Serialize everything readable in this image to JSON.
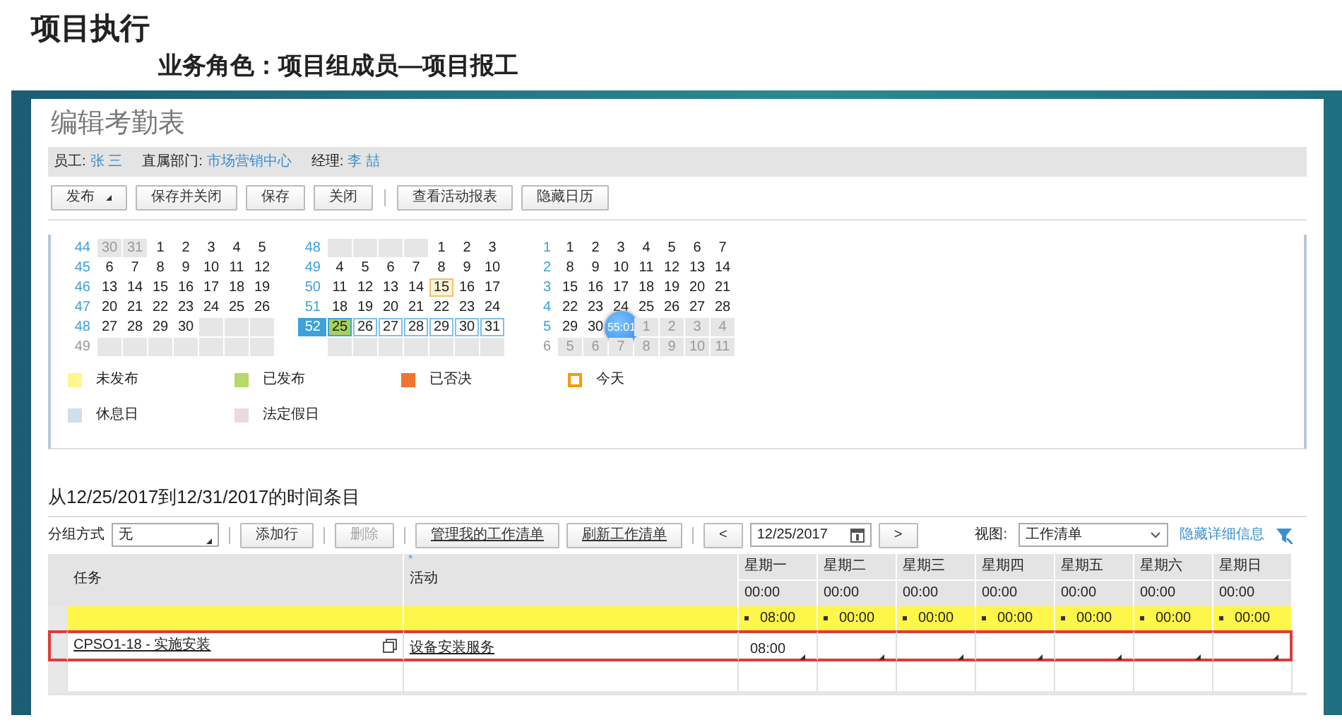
{
  "slide": {
    "title": "项目执行",
    "subtitle": "业务角色：项目组成员—项目报工"
  },
  "window": {
    "title": "编辑考勤表"
  },
  "info_bar": [
    {
      "label": "员工:",
      "value": "张 三"
    },
    {
      "label": "直属部门:",
      "value": "市场营销中心"
    },
    {
      "label": "经理:",
      "value": "李 喆"
    }
  ],
  "toolbar": [
    {
      "kind": "menu",
      "label": "发布"
    },
    {
      "kind": "button",
      "label": "保存并关闭"
    },
    {
      "kind": "button",
      "label": "保存"
    },
    {
      "kind": "button",
      "label": "关闭"
    },
    {
      "kind": "separator"
    },
    {
      "kind": "button",
      "label": "查看活动报表"
    },
    {
      "kind": "button",
      "label": "隐藏日历"
    }
  ],
  "calendar": {
    "months": [
      {
        "weeks": [
          {
            "week": "44",
            "dim": false,
            "selected": false,
            "days": [
              {
                "day": "30",
                "kind": "other"
              },
              {
                "day": "31",
                "kind": "other"
              },
              {
                "day": "1",
                "kind": "day"
              },
              {
                "day": "2",
                "kind": "day"
              },
              {
                "day": "3",
                "kind": "day"
              },
              {
                "day": "4",
                "kind": "day"
              },
              {
                "day": "5",
                "kind": "day"
              }
            ]
          },
          {
            "week": "45",
            "dim": false,
            "selected": false,
            "days": [
              {
                "day": "6",
                "kind": "day"
              },
              {
                "day": "7",
                "kind": "day"
              },
              {
                "day": "8",
                "kind": "day"
              },
              {
                "day": "9",
                "kind": "day"
              },
              {
                "day": "10",
                "kind": "day"
              },
              {
                "day": "11",
                "kind": "day"
              },
              {
                "day": "12",
                "kind": "day"
              }
            ]
          },
          {
            "week": "46",
            "dim": false,
            "selected": false,
            "days": [
              {
                "day": "13",
                "kind": "day"
              },
              {
                "day": "14",
                "kind": "day"
              },
              {
                "day": "15",
                "kind": "day"
              },
              {
                "day": "16",
                "kind": "day"
              },
              {
                "day": "17",
                "kind": "day"
              },
              {
                "day": "18",
                "kind": "day"
              },
              {
                "day": "19",
                "kind": "day"
              }
            ]
          },
          {
            "week": "47",
            "dim": false,
            "selected": false,
            "days": [
              {
                "day": "20",
                "kind": "day"
              },
              {
                "day": "21",
                "kind": "day"
              },
              {
                "day": "22",
                "kind": "day"
              },
              {
                "day": "23",
                "kind": "day"
              },
              {
                "day": "24",
                "kind": "day"
              },
              {
                "day": "25",
                "kind": "day"
              },
              {
                "day": "26",
                "kind": "day"
              }
            ]
          },
          {
            "week": "48",
            "dim": false,
            "selected": false,
            "days": [
              {
                "day": "27",
                "kind": "day"
              },
              {
                "day": "28",
                "kind": "day"
              },
              {
                "day": "29",
                "kind": "day"
              },
              {
                "day": "30",
                "kind": "day"
              },
              {
                "kind": "blank"
              },
              {
                "kind": "blank"
              },
              {
                "kind": "blank"
              }
            ]
          },
          {
            "week": "49",
            "dim": true,
            "selected": false,
            "days": [
              {
                "kind": "blank"
              },
              {
                "kind": "blank"
              },
              {
                "kind": "blank"
              },
              {
                "kind": "blank"
              },
              {
                "kind": "blank"
              },
              {
                "kind": "blank"
              },
              {
                "kind": "blank"
              }
            ]
          }
        ]
      },
      {
        "weeks": [
          {
            "week": "48",
            "dim": false,
            "selected": false,
            "days": [
              {
                "kind": "blank"
              },
              {
                "kind": "blank"
              },
              {
                "kind": "blank"
              },
              {
                "kind": "blank"
              },
              {
                "day": "1",
                "kind": "day"
              },
              {
                "day": "2",
                "kind": "day"
              },
              {
                "day": "3",
                "kind": "day"
              }
            ]
          },
          {
            "week": "49",
            "dim": false,
            "selected": false,
            "days": [
              {
                "day": "4",
                "kind": "day"
              },
              {
                "day": "5",
                "kind": "day"
              },
              {
                "day": "6",
                "kind": "day"
              },
              {
                "day": "7",
                "kind": "day"
              },
              {
                "day": "8",
                "kind": "day"
              },
              {
                "day": "9",
                "kind": "day"
              },
              {
                "day": "10",
                "kind": "day"
              }
            ]
          },
          {
            "week": "50",
            "dim": false,
            "selected": false,
            "days": [
              {
                "day": "11",
                "kind": "day"
              },
              {
                "day": "12",
                "kind": "day"
              },
              {
                "day": "13",
                "kind": "day"
              },
              {
                "day": "14",
                "kind": "day"
              },
              {
                "day": "15",
                "kind": "today"
              },
              {
                "day": "16",
                "kind": "day"
              },
              {
                "day": "17",
                "kind": "day"
              }
            ]
          },
          {
            "week": "51",
            "dim": false,
            "selected": false,
            "days": [
              {
                "day": "18",
                "kind": "day"
              },
              {
                "day": "19",
                "kind": "day"
              },
              {
                "day": "20",
                "kind": "day"
              },
              {
                "day": "21",
                "kind": "day"
              },
              {
                "day": "22",
                "kind": "day"
              },
              {
                "day": "23",
                "kind": "day"
              },
              {
                "day": "24",
                "kind": "day"
              }
            ]
          },
          {
            "week": "52",
            "dim": false,
            "selected": true,
            "days": [
              {
                "day": "25",
                "kind": "published"
              },
              {
                "day": "26",
                "kind": "inweek"
              },
              {
                "day": "27",
                "kind": "inweek"
              },
              {
                "day": "28",
                "kind": "inweek"
              },
              {
                "day": "29",
                "kind": "inweek"
              },
              {
                "day": "30",
                "kind": "inweek"
              },
              {
                "day": "31",
                "kind": "inweek"
              }
            ]
          },
          {
            "days": [
              {
                "kind": "blank"
              },
              {
                "kind": "blank"
              },
              {
                "kind": "blank"
              },
              {
                "kind": "blank"
              },
              {
                "kind": "blank"
              },
              {
                "kind": "blank"
              },
              {
                "kind": "blank"
              }
            ]
          }
        ]
      },
      {
        "weeks": [
          {
            "week": "1",
            "dim": false,
            "selected": false,
            "days": [
              {
                "day": "1",
                "kind": "day"
              },
              {
                "day": "2",
                "kind": "day"
              },
              {
                "day": "3",
                "kind": "day"
              },
              {
                "day": "4",
                "kind": "day"
              },
              {
                "day": "5",
                "kind": "day"
              },
              {
                "day": "6",
                "kind": "day"
              },
              {
                "day": "7",
                "kind": "day"
              }
            ]
          },
          {
            "week": "2",
            "dim": false,
            "selected": false,
            "days": [
              {
                "day": "8",
                "kind": "day"
              },
              {
                "day": "9",
                "kind": "day"
              },
              {
                "day": "10",
                "kind": "day"
              },
              {
                "day": "11",
                "kind": "day"
              },
              {
                "day": "12",
                "kind": "day"
              },
              {
                "day": "13",
                "kind": "day"
              },
              {
                "day": "14",
                "kind": "day"
              }
            ]
          },
          {
            "week": "3",
            "dim": false,
            "selected": false,
            "days": [
              {
                "day": "15",
                "kind": "day"
              },
              {
                "day": "16",
                "kind": "day"
              },
              {
                "day": "17",
                "kind": "day"
              },
              {
                "day": "18",
                "kind": "day"
              },
              {
                "day": "19",
                "kind": "day"
              },
              {
                "day": "20",
                "kind": "day"
              },
              {
                "day": "21",
                "kind": "day"
              }
            ]
          },
          {
            "week": "4",
            "dim": false,
            "selected": false,
            "days": [
              {
                "day": "22",
                "kind": "day"
              },
              {
                "day": "23",
                "kind": "day"
              },
              {
                "day": "24",
                "kind": "day"
              },
              {
                "day": "25",
                "kind": "day"
              },
              {
                "day": "26",
                "kind": "day"
              },
              {
                "day": "27",
                "kind": "day"
              },
              {
                "day": "28",
                "kind": "day"
              }
            ]
          },
          {
            "week": "5",
            "dim": false,
            "selected": false,
            "days": [
              {
                "day": "29",
                "kind": "day"
              },
              {
                "day": "30",
                "kind": "day"
              },
              {
                "day": "55:01",
                "kind": "timer"
              },
              {
                "day": "1",
                "kind": "other"
              },
              {
                "day": "2",
                "kind": "other"
              },
              {
                "day": "3",
                "kind": "other"
              },
              {
                "day": "4",
                "kind": "other"
              }
            ]
          },
          {
            "week": "6",
            "dim": true,
            "selected": false,
            "days": [
              {
                "day": "5",
                "kind": "other"
              },
              {
                "day": "6",
                "kind": "other"
              },
              {
                "day": "7",
                "kind": "other"
              },
              {
                "day": "8",
                "kind": "other"
              },
              {
                "day": "9",
                "kind": "other"
              },
              {
                "day": "10",
                "kind": "other"
              },
              {
                "day": "11",
                "kind": "other"
              }
            ]
          }
        ]
      }
    ],
    "legend": [
      {
        "label": "未发布",
        "color": "#fff68f",
        "kind": "fill"
      },
      {
        "label": "已发布",
        "color": "#b5d96a",
        "kind": "fill"
      },
      {
        "label": "已否决",
        "color": "#f07530",
        "kind": "fill"
      },
      {
        "label": "今天",
        "color": "#f59d00",
        "kind": "outline"
      },
      {
        "label": "休息日",
        "color": "#cfdfec",
        "kind": "fill"
      },
      {
        "label": "法定假日",
        "color": "#e8dae2",
        "kind": "fill"
      }
    ]
  },
  "entries": {
    "title": "从12/25/2017到12/31/2017的时间条目",
    "toolbar_left": [
      {
        "kind": "label",
        "text": "分组方式"
      },
      {
        "kind": "select",
        "text": "无"
      },
      {
        "kind": "separator"
      },
      {
        "kind": "button",
        "text": "添加行",
        "disabled": false,
        "underlined": false
      },
      {
        "kind": "separator"
      },
      {
        "kind": "button",
        "text": "删除",
        "disabled": true,
        "underlined": false
      },
      {
        "kind": "separator"
      },
      {
        "kind": "button",
        "text": "管理我的工作清单",
        "disabled": false,
        "underlined": true
      },
      {
        "kind": "button",
        "text": "刷新工作清单",
        "disabled": false,
        "underlined": true
      },
      {
        "kind": "separator"
      },
      {
        "kind": "button",
        "text": "<",
        "disabled": false,
        "underlined": false
      },
      {
        "kind": "date",
        "text": "12/25/2017"
      },
      {
        "kind": "button",
        "text": ">",
        "disabled": false,
        "underlined": false
      }
    ],
    "toolbar_right": [
      {
        "kind": "label",
        "text": "视图:"
      },
      {
        "kind": "dropdown",
        "text": "工作清单"
      },
      {
        "kind": "link",
        "text": "隐藏详细信息"
      },
      {
        "kind": "filter"
      }
    ],
    "table": {
      "columns": [
        {
          "label": "任务",
          "required": false
        },
        {
          "label": "活动",
          "required": true
        }
      ],
      "required_mark": "*",
      "days": [
        {
          "name": "星期一",
          "total": "00:00"
        },
        {
          "name": "星期二",
          "total": "00:00"
        },
        {
          "name": "星期三",
          "total": "00:00"
        },
        {
          "name": "星期四",
          "total": "00:00"
        },
        {
          "name": "星期五",
          "total": "00:00"
        },
        {
          "name": "星期六",
          "total": "00:00"
        },
        {
          "name": "星期日",
          "total": "00:00"
        }
      ],
      "totals": [
        "08:00",
        "00:00",
        "00:00",
        "00:00",
        "00:00",
        "00:00",
        "00:00"
      ],
      "rows": [
        {
          "task": "CPSO1-18 - 实施安装",
          "activity": "设备安装服务",
          "hours": [
            "08:00"
          ],
          "selected": true
        },
        {
          "selected": false
        }
      ]
    }
  }
}
